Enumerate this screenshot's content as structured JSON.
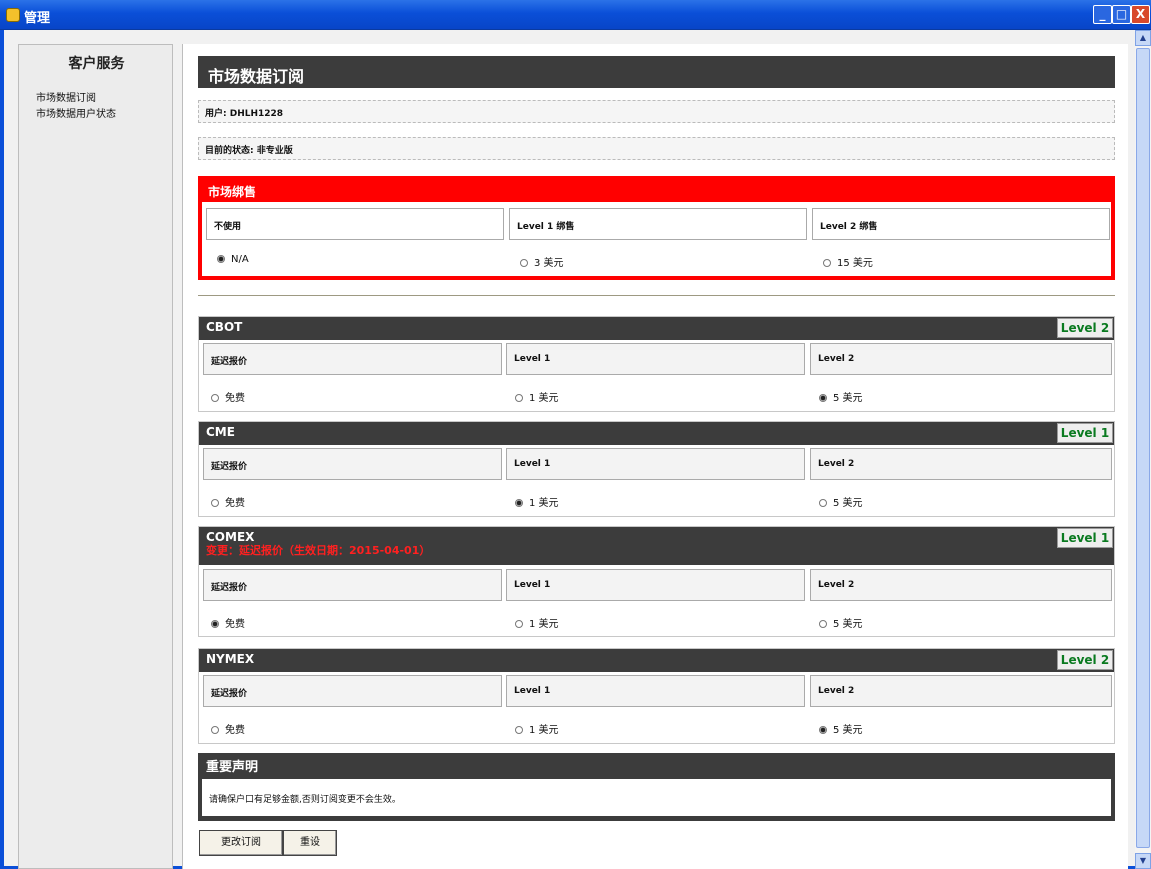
{
  "window": {
    "title": "管理",
    "buttons": {
      "minimize": "_",
      "maximize": "□",
      "close": "X"
    }
  },
  "sidebar": {
    "title": "客户服务",
    "items": [
      "市场数据订阅",
      "市场数据用户状态"
    ]
  },
  "page": {
    "title": "市场数据订阅",
    "user": "用户: DHLH1228",
    "status": "目前的状态: 非专业版"
  },
  "bundle": {
    "title": "市场绑售",
    "options": [
      {
        "label": "不使用",
        "value": "N/A",
        "checked": true
      },
      {
        "label": "Level 1 绑售",
        "value": "3 美元",
        "checked": false
      },
      {
        "label": "Level 2 绑售",
        "value": "15 美元",
        "checked": false
      }
    ]
  },
  "markets": [
    {
      "name": "CBOT",
      "notice": "",
      "level": "Level 2",
      "options": [
        {
          "label": "延迟报价",
          "value": "免费",
          "checked": false
        },
        {
          "label": "Level 1",
          "value": "1 美元",
          "checked": false
        },
        {
          "label": "Level 2",
          "value": "5 美元",
          "checked": true
        }
      ]
    },
    {
      "name": "CME",
      "notice": "",
      "level": "Level 1",
      "options": [
        {
          "label": "延迟报价",
          "value": "免费",
          "checked": false
        },
        {
          "label": "Level 1",
          "value": "1 美元",
          "checked": true
        },
        {
          "label": "Level 2",
          "value": "5 美元",
          "checked": false
        }
      ]
    },
    {
      "name": "COMEX",
      "notice": "变更：延迟报价（生效日期：2015-04-01）",
      "level": "Level 1",
      "options": [
        {
          "label": "延迟报价",
          "value": "免费",
          "checked": true
        },
        {
          "label": "Level 1",
          "value": "1 美元",
          "checked": false
        },
        {
          "label": "Level 2",
          "value": "5 美元",
          "checked": false
        }
      ]
    },
    {
      "name": "NYMEX",
      "notice": "",
      "level": "Level 2",
      "options": [
        {
          "label": "延迟报价",
          "value": "免费",
          "checked": false
        },
        {
          "label": "Level 1",
          "value": "1 美元",
          "checked": false
        },
        {
          "label": "Level 2",
          "value": "5 美元",
          "checked": true
        }
      ]
    }
  ],
  "declaration": {
    "title": "重要声明",
    "text": "请确保户口有足够金额,否则订阅变更不会生效。"
  },
  "actions": {
    "submit": "更改订阅",
    "reset": "重设"
  },
  "colors": {
    "accent_red": "#ff0000",
    "section_dark": "#3c3c3c",
    "level_green": "#0a7a20"
  }
}
